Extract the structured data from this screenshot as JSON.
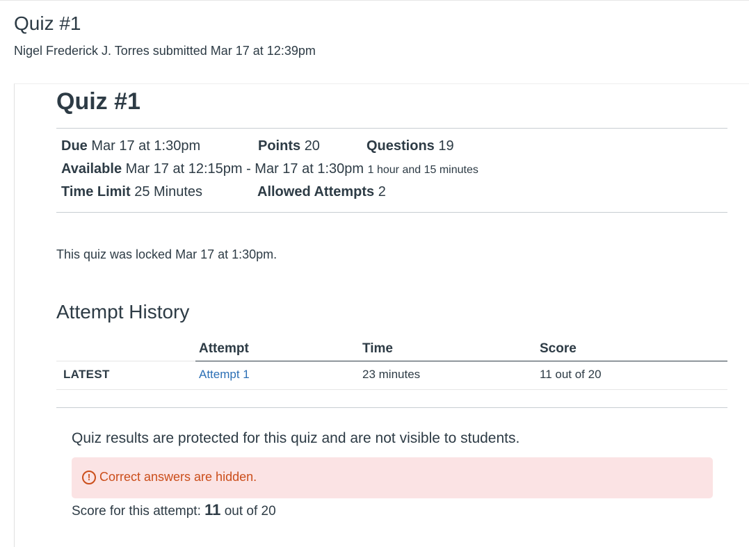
{
  "header": {
    "title": "Quiz #1",
    "submitted_text": "Nigel Frederick J. Torres submitted Mar 17 at 12:39pm"
  },
  "quiz": {
    "title": "Quiz #1",
    "due_label": "Due",
    "due_value": "Mar 17 at 1:30pm",
    "points_label": "Points",
    "points_value": "20",
    "questions_label": "Questions",
    "questions_value": "19",
    "available_label": "Available",
    "available_value": "Mar 17 at 12:15pm - Mar 17 at 1:30pm",
    "available_duration": "1 hour and 15 minutes",
    "time_limit_label": "Time Limit",
    "time_limit_value": "25 Minutes",
    "attempts_label": "Allowed Attempts",
    "attempts_value": "2",
    "locked_message": "This quiz was locked Mar 17 at 1:30pm."
  },
  "attempt_history": {
    "title": "Attempt History",
    "columns": [
      "Attempt",
      "Time",
      "Score"
    ],
    "rows": [
      {
        "badge": "LATEST",
        "attempt": "Attempt 1",
        "time": "23 minutes",
        "score": "11 out of 20"
      }
    ]
  },
  "results": {
    "protected_message": "Quiz results are protected for this quiz and are not visible to students.",
    "alert_text": "Correct answers are hidden.",
    "alert_icon": "warning-circle-icon",
    "score_prefix": "Score for this attempt:",
    "score_value": "11",
    "score_suffix": "out of 20"
  },
  "colors": {
    "text": "#2d3b45",
    "link": "#2b6fb5",
    "alert_bg": "#fbe3e4",
    "alert_text": "#cb4e1b"
  }
}
